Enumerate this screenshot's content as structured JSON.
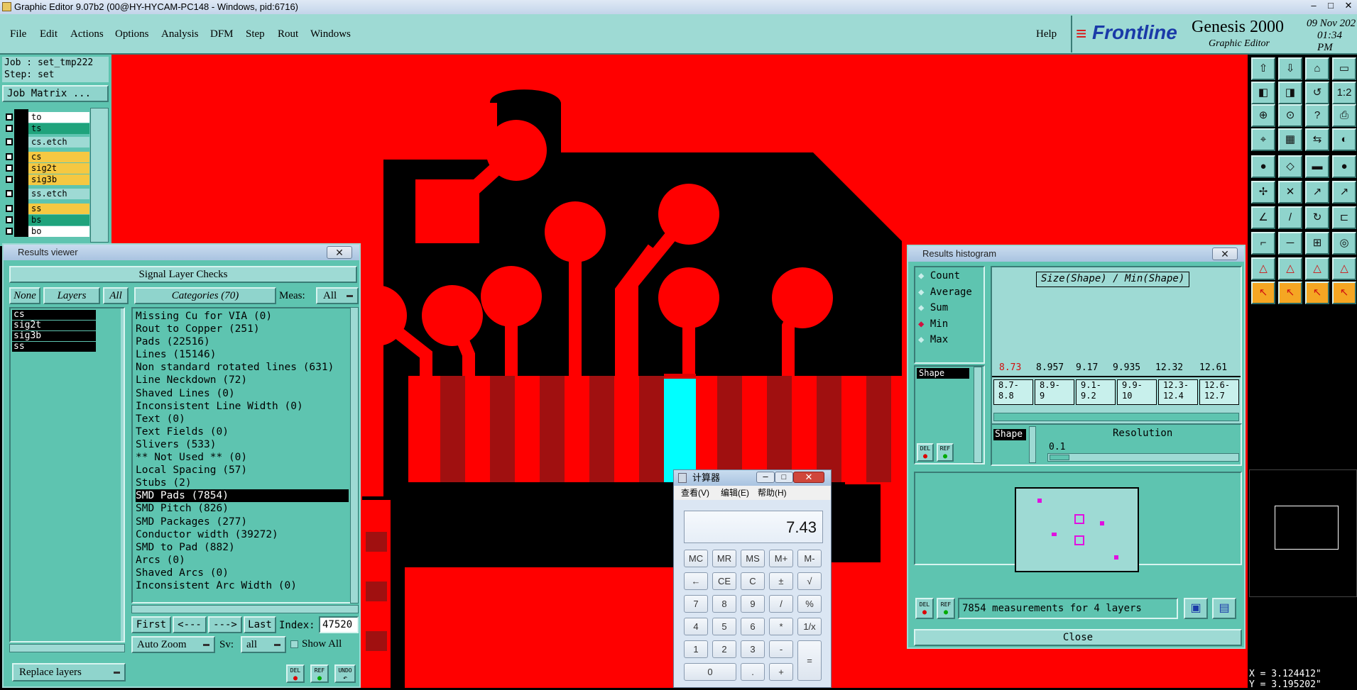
{
  "window_title": "Graphic Editor 9.07b2 (00@HY-HYCAM-PC148 - Windows, pid:6716)",
  "menu": [
    "File",
    "Edit",
    "Actions",
    "Options",
    "Analysis",
    "DFM",
    "Step",
    "Rout",
    "Windows"
  ],
  "help": "Help",
  "brand": {
    "logo": "Frontline",
    "product": "Genesis 2000",
    "subtitle": "Graphic Editor",
    "date": "09 Nov 202",
    "time": "01:34 PM"
  },
  "job": {
    "job_line": "Job : set_tmp222",
    "step_line": "Step: set",
    "matrix_button": "Job Matrix ..."
  },
  "layers": [
    {
      "name": "to",
      "color": "#ffffff"
    },
    {
      "name": "ts",
      "color": "#1fa37c"
    },
    {
      "name": "cs.etch",
      "color": "#9edad4"
    },
    {
      "name": "cs",
      "color": "#f5c842"
    },
    {
      "name": "sig2t",
      "color": "#f5c842"
    },
    {
      "name": "sig3b",
      "color": "#f5c842"
    },
    {
      "name": "ss.etch",
      "color": "#9edad4"
    },
    {
      "name": "ss",
      "color": "#f5c842"
    },
    {
      "name": "bs",
      "color": "#1fa37c"
    },
    {
      "name": "bo",
      "color": "#ffffff"
    }
  ],
  "results_viewer": {
    "title": "Results viewer",
    "header": "Signal Layer Checks",
    "none_btn": "None",
    "layers_btn": "Layers",
    "all_btn": "All",
    "categories_btn": "Categories (70)",
    "meas_label": "Meas:",
    "meas_value": "All",
    "layer_list": [
      "cs",
      "sig2t",
      "sig3b",
      "ss"
    ],
    "categories": [
      "Missing Cu for VIA (0)",
      "Rout to Copper (251)",
      "Pads (22516)",
      "Lines (15146)",
      "Non standard rotated lines (631)",
      "Line Neckdown (72)",
      "Shaved Lines (0)",
      "Inconsistent Line Width (0)",
      "Text (0)",
      "Text Fields (0)",
      "Slivers (533)",
      "** Not Used ** (0)",
      "Local Spacing (57)",
      "Stubs (2)",
      "SMD Pads (7854)",
      "SMD Pitch (826)",
      "SMD Packages (277)",
      "Conductor width (39272)",
      "SMD to Pad (882)",
      "Arcs (0)",
      "Shaved Arcs (0)",
      "Inconsistent Arc Width (0)"
    ],
    "selected_index": 14,
    "first_btn": "First",
    "prev_btn": "<---",
    "next_btn": "--->",
    "last_btn": "Last",
    "index_label": "Index:",
    "index_value": "47520",
    "auto_zoom": "Auto Zoom",
    "sv_label": "Sv:",
    "sv_value": "all",
    "show_all": "Show All",
    "replace_layers": "Replace layers",
    "del": "DEL",
    "ref": "REF",
    "undo": "UNDO"
  },
  "histogram": {
    "title": "Results histogram",
    "options": [
      "Count",
      "Average",
      "Sum",
      "Min",
      "Max"
    ],
    "selected_option": "Min",
    "graph_title": "Size(Shape) / Min(Shape)",
    "shape_item": "Shape",
    "bin_values": [
      "8.73",
      "8.957",
      "9.17",
      "9.935",
      "12.32",
      "12.61"
    ],
    "bin_ranges": [
      [
        "8.7-",
        "8.8"
      ],
      [
        "8.9-",
        "9"
      ],
      [
        "9.1-",
        "9.2"
      ],
      [
        "9.9-",
        "10"
      ],
      [
        "12.3-",
        "12.4"
      ],
      [
        "12.6-",
        "12.7"
      ]
    ],
    "shape_label": "Shape",
    "resolution_label": "Resolution",
    "resolution_value": "0.1",
    "status": "7854 measurements for 4 layers",
    "close": "Close",
    "del": "DEL",
    "ref": "REF"
  },
  "calculator": {
    "title": "计算器",
    "menu": [
      "查看(V)",
      "编辑(E)",
      "帮助(H)"
    ],
    "display": "7.43",
    "rows": [
      [
        "MC",
        "MR",
        "MS",
        "M+",
        "M-"
      ],
      [
        "←",
        "CE",
        "C",
        "±",
        "√"
      ],
      [
        "7",
        "8",
        "9",
        "/",
        "%"
      ],
      [
        "4",
        "5",
        "6",
        "*",
        "1/x"
      ],
      [
        "1",
        "2",
        "3",
        "-",
        "="
      ],
      [
        "0",
        ".",
        "+"
      ]
    ]
  },
  "coords": {
    "x": "X = 3.124412\"",
    "y": "Y = 3.195202\""
  },
  "colors": {
    "panel": "#5ec4b0",
    "light": "#9edad4",
    "copper": "#ff0000",
    "highlight": "#00ffff"
  }
}
